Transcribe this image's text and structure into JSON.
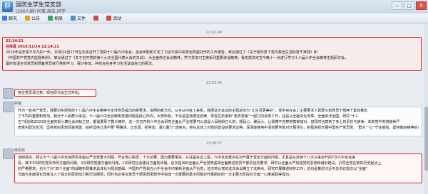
{
  "window": {
    "title": "国防生学生党支部",
    "subtitle": "(200人群) 同事,朋友,同学",
    "avatar_glyph": "群",
    "controls": {
      "minimize": "—",
      "maximize": "□",
      "close": "✕"
    }
  },
  "toolbar": {
    "items": [
      {
        "label": "聊天",
        "icon": "chat-icon",
        "color": "#3b7dd8"
      },
      {
        "label": "公告",
        "icon": "announcement-icon",
        "color": "#e0a020"
      },
      {
        "label": "相册",
        "icon": "album-icon",
        "color": "#3aa35c"
      },
      {
        "label": "文件",
        "icon": "file-icon",
        "color": "#4a90d9"
      },
      {
        "label": "",
        "icon": "apps-icon",
        "color": "#c94f4f"
      },
      {
        "label": "活动",
        "icon": "activity-icon",
        "color": "#d24b2f"
      }
    ]
  },
  "messages": [
    {
      "timestamp": "22:42:48",
      "sender": "",
      "style": "red-highlight",
      "lines": [
        "22:14:21",
        "任侬禹 2016/11/14 22:14:21",
        "2016年是非常不平凡的一年。10月24至27日在北京召开了党的十八届六中全会，全会听取和讨论了习近平受中央政治局委托作的工作报告，审议通过了《关于新形势下党内政治生活的若干准则》和",
        "《中国共产党党内监督条例》，审议通过了《关于召开党的第十九次全国代表大会的决议》。为全面传达会议精神，学习贯彻习主席系列重要讲话精神，我支部决定在今晚十一点进行学习十八届六中全会精神主题研讨会，",
        "届时有请全体党员和预备党员就行搭和学习、探讨参加，并结合自身学习生活谈谈自己的看法。"
      ]
    },
    {
      "timestamp": "23:03:45",
      "sender": "",
      "style": "red-box",
      "lines": [
        "各位党员请注意，现在研讨会正式开始。"
      ]
    },
    {
      "timestamp": "",
      "sender": "胖猪",
      "style": "normal",
      "lines": [
        "作为一名共产党员，我要切实把党的十八届六中全会精神与全体党员提出的新要求，指明的新方向。从全从内容上来看，我把这次会议的主题总结为“让生活更美好”，党中央在会上主要要求人民群众和党员干部两个集体推出",
        "了不同的重要和规范。我对于人民群众来说，十八届六中全会聚焦党建问题是民心所向，大势所趋，不论是坚持廉洁自律，零容忍态度和“老虎苍蝇”一起打的反腐工作，还是从全面深化改革，全面依法治国，研究“十三",
        "五”规划和2020年全面实现小康社会目标之初，都需要厚了群众拥护。这一次召开的六中全会研究全面从严治党要可以说是人民盼盼已久的，顺民心、聚民心，让我懂不自禁地鼓掌如对，但同时也感到了身上的责任与使命。未来党中央将继续严",
        "肃党内政治生活，坚持党的思想武装党建，始终坚持立场不要“明确求，正本源、抓常态，凝心聚力”这两点，将在总体上对党的建设的要求这种，深深能够用中深刻要件数对开展评价，积极讲授开展中国共产党员党，“群众一心”守住底线，紧持做好精神的本党建。"
      ]
    },
    {
      "timestamp": "23:06:07",
      "sender": "杨凯政",
      "style": "red-box",
      "lines": [
        "谈到观点，我认为十八届六中全会研究全面从严治党重大问题，符合党心民愿，十分必要。因为重要事实，从往届会议上看，六中全会重点在对开展于党全方面的问题，尤其是从反映十八大以来召开的7次六中全会来",
        "看，其中3次研究党风作风方面的问题，3次研究党建方面的问题，1次研究社会建设方面的问题。这次提出的全面从严治党既强调全面推进党员干部队伍的要求，研究以全面从严加强党的思想和组织建设，引导全党在新的历史起点上",
        "的严格要求。也为了对“四个全面”的战略布局推进具体化为规划基础，中国共产党是在六中全会中印第新全面从严治党，这次将以党的这次会议确立了这两点，研究开展推进好好工作，这也是推进习近平总书记首次以“全面”",
        "方面为全面深化改革注入了强大的思想动力和行动纲领，同时也必将在党员干部思想思想作中完成一次重要的重大问题对开展组织的一次主要大阶段对方面一心推进取得成功。"
      ]
    }
  ]
}
